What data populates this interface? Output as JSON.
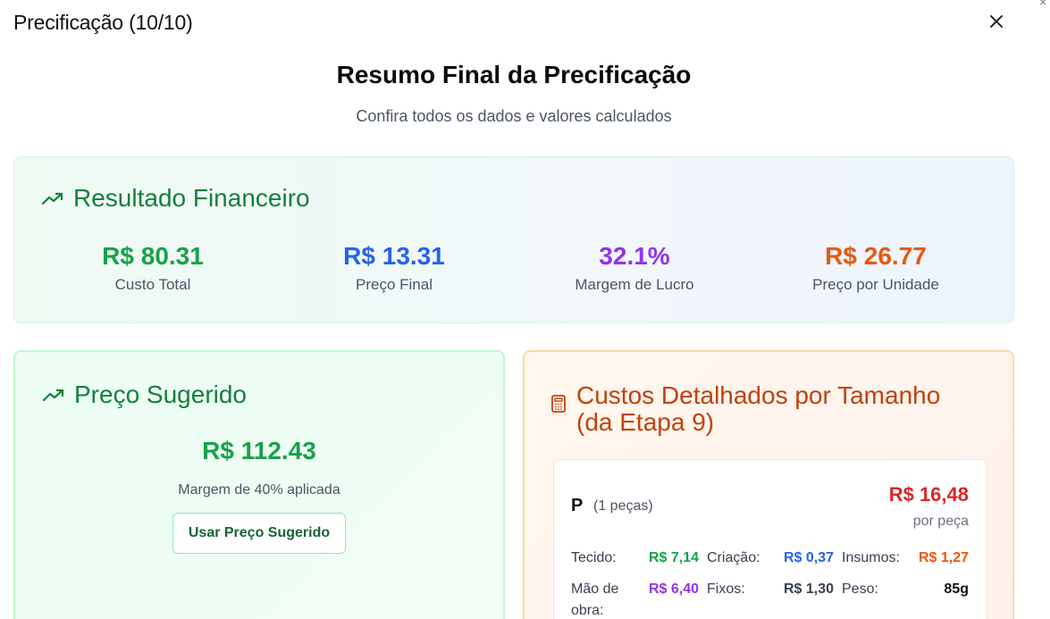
{
  "dialog": {
    "title": "Precificação (10/10)"
  },
  "summary": {
    "title": "Resumo Final da Precificação",
    "subtitle": "Confira todos os dados e valores calculados"
  },
  "financial": {
    "heading": "Resultado Financeiro",
    "icon": "trending-up-icon",
    "stats": [
      {
        "value": "R$ 80.31",
        "label": "Custo Total",
        "color": "#16a34a"
      },
      {
        "value": "R$ 13.31",
        "label": "Preço Final",
        "color": "#2563eb"
      },
      {
        "value": "32.1%",
        "label": "Margem de Lucro",
        "color": "#9333ea"
      },
      {
        "value": "R$ 26.77",
        "label": "Preço por Unidade",
        "color": "#ea580c"
      }
    ]
  },
  "suggested": {
    "heading": "Preço Sugerido",
    "icon": "trending-up-icon",
    "price": "R$ 112.43",
    "note": "Margem de 40% aplicada",
    "button": "Usar Preço Sugerido"
  },
  "costs": {
    "heading_line1": "Custos Detalhados por Tamanho",
    "heading_line2": "(da Etapa 9)",
    "icon": "calculator-icon",
    "sizes": [
      {
        "name": "P",
        "count": "(1 peças)",
        "total": "R$ 16,48",
        "unit": "por peça",
        "rows": [
          [
            {
              "label": "Tecido:",
              "value": "R$ 7,14",
              "color": "#16a34a"
            },
            {
              "label": "Criação:",
              "value": "R$ 0,37",
              "color": "#2563eb"
            },
            {
              "label": "Insumos:",
              "value": "R$ 1,27",
              "color": "#ea580c"
            }
          ],
          [
            {
              "label": "Mão de obra:",
              "value": "R$ 6,40",
              "color": "#9333ea"
            },
            {
              "label": "Fixos:",
              "value": "R$ 1,30",
              "color": "#374151"
            },
            {
              "label": "Peso:",
              "value": "85g",
              "color": "#111111"
            }
          ]
        ]
      }
    ]
  }
}
